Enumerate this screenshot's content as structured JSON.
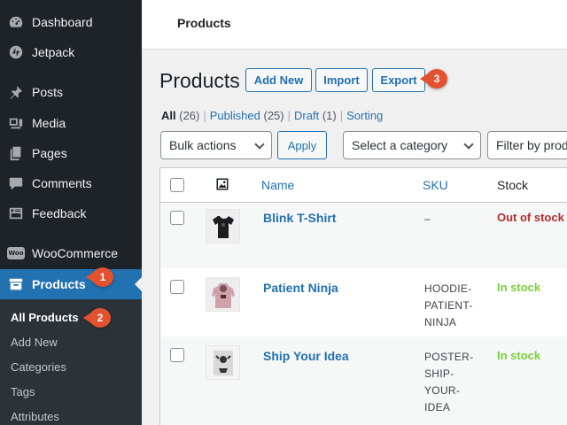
{
  "sidebar": {
    "items": [
      {
        "label": "Dashboard",
        "icon": "dashboard-icon"
      },
      {
        "label": "Jetpack",
        "icon": "jetpack-icon"
      },
      {
        "label": "Posts",
        "icon": "pin-icon"
      },
      {
        "label": "Media",
        "icon": "media-icon"
      },
      {
        "label": "Pages",
        "icon": "pages-icon"
      },
      {
        "label": "Comments",
        "icon": "comment-icon"
      },
      {
        "label": "Feedback",
        "icon": "feedback-icon"
      },
      {
        "label": "WooCommerce",
        "icon": "woo-icon"
      },
      {
        "label": "Products",
        "icon": "archive-icon"
      }
    ],
    "woo_icon_text": "Woo",
    "submenu": [
      "All Products",
      "Add New",
      "Categories",
      "Tags",
      "Attributes"
    ]
  },
  "badges": [
    "1",
    "2",
    "3"
  ],
  "topbar": {
    "title": "Products"
  },
  "page": {
    "title": "Products",
    "buttons": {
      "add_new": "Add New",
      "import": "Import",
      "export": "Export"
    }
  },
  "views": {
    "all": "All",
    "all_count": "(26)",
    "published": "Published",
    "published_count": "(25)",
    "draft": "Draft",
    "draft_count": "(1)",
    "sorting": "Sorting",
    "sep": "|"
  },
  "filters": {
    "bulk_actions": "Bulk actions",
    "apply": "Apply",
    "category": "Select a category",
    "product_type": "Filter by product type"
  },
  "table": {
    "columns": {
      "name": "Name",
      "sku": "SKU",
      "stock": "Stock"
    },
    "rows": [
      {
        "name": "Blink T-Shirt",
        "sku": [
          "–"
        ],
        "stock": "Out of stock",
        "stock_color": "#b32d2e"
      },
      {
        "name": "Patient Ninja",
        "sku": [
          "HOODIE-",
          "PATIENT-",
          "NINJA"
        ],
        "stock": "In stock",
        "stock_color": "#7ad03a"
      },
      {
        "name": "Ship Your Idea",
        "sku": [
          "POSTER-",
          "SHIP-",
          "YOUR-",
          "IDEA"
        ],
        "stock": "In stock",
        "stock_color": "#7ad03a"
      }
    ]
  },
  "colors": {
    "accent": "#2271b1",
    "sidebar": "#1d2327",
    "badge": "#e4512f"
  }
}
